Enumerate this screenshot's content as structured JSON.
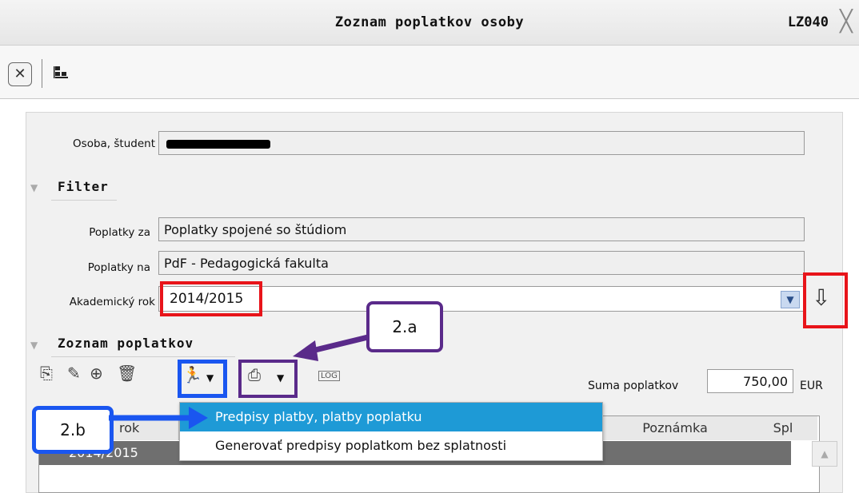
{
  "window": {
    "title": "Zoznam poplatkov osoby",
    "code": "LZ040"
  },
  "toolbar": {
    "close_icon": "close-icon",
    "tree_icon": "hierarchy-icon"
  },
  "person": {
    "label": "Osoba, študent",
    "value": ""
  },
  "filter": {
    "title": "Filter",
    "fees_for_label": "Poplatky za",
    "fees_for_value": "Poplatky spojené so štúdiom",
    "fees_on_label": "Poplatky na",
    "fees_on_value": "PdF - Pedagogická fakulta",
    "year_label": "Akademický rok",
    "year_value": "2014/2015"
  },
  "fee_list": {
    "title": "Zoznam poplatkov",
    "sum_label": "Suma poplatkov",
    "sum_value": "750,00",
    "currency": "EUR",
    "columns": [
      "rok",
      "Poznámka",
      "Spl"
    ],
    "rows": [
      {
        "rok": "2014/2015"
      }
    ]
  },
  "menu": {
    "items": [
      "Predpisy platby, platby poplatku",
      "Generovať predpisy poplatkom bez splatnosti"
    ]
  },
  "annotations": {
    "callout_a": "2.a",
    "callout_b": "2.b",
    "purple": "#5a2a8a",
    "blue": "#1a56f0",
    "red": "#e8141a"
  }
}
